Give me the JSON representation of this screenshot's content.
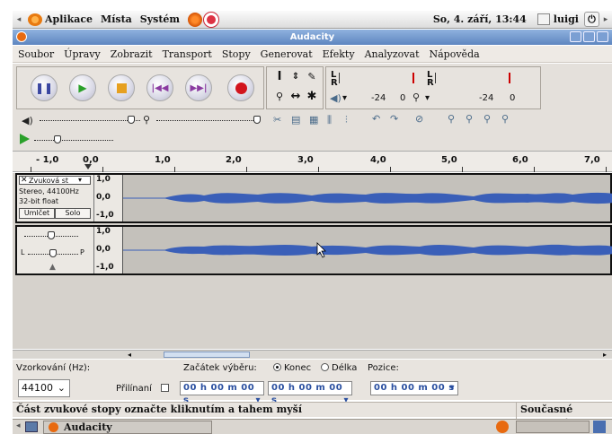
{
  "panel": {
    "menus": [
      "Aplikace",
      "Místa",
      "Systém"
    ],
    "datetime": "So, 4. září, 13:44",
    "user": "luigi"
  },
  "window": {
    "title": "Audacity"
  },
  "menubar": {
    "items": [
      "Soubor",
      "Úpravy",
      "Zobrazit",
      "Transport",
      "Stopy",
      "Generovat",
      "Efekty",
      "Analyzovat",
      "Nápověda"
    ]
  },
  "meters": {
    "play_l": "L",
    "play_r": "R",
    "rec_l": "L",
    "rec_r": "R",
    "ticks": [
      "-24",
      "0",
      "-24",
      "0"
    ]
  },
  "ruler": {
    "labels": [
      "- 1,0",
      "0,0",
      "1,0",
      "2,0",
      "3,0",
      "4,0",
      "5,0",
      "6,0",
      "7,0"
    ]
  },
  "track": {
    "name": "Zvuková st",
    "info_rate": "Stereo, 44100Hz",
    "info_format": "32-bit float",
    "mute_label": "Umlčet",
    "solo_label": "Solo",
    "pan_l": "L",
    "pan_r": "P",
    "scale_top": [
      "1,0",
      "0,0",
      "-1,0"
    ],
    "scale_bottom": [
      "1,0",
      "0,0",
      "-1,0"
    ]
  },
  "selection": {
    "rate_label": "Vzorkování (Hz):",
    "rate_value": "44100",
    "start_label": "Začátek výběru:",
    "end_label": "Konec",
    "length_label": "Délka",
    "position_label": "Pozice:",
    "snap_label": "Přilínaní",
    "time_start": "00 h 00 m 00 s",
    "time_end": "00 h 00 m 00 s",
    "time_pos": "00 h 00 m 00 s"
  },
  "status": {
    "message": "Část zvukové stopy označte kliknutím a tahem myší",
    "right": "Současné vzorková"
  },
  "taskbar": {
    "window_label": "Audacity"
  }
}
